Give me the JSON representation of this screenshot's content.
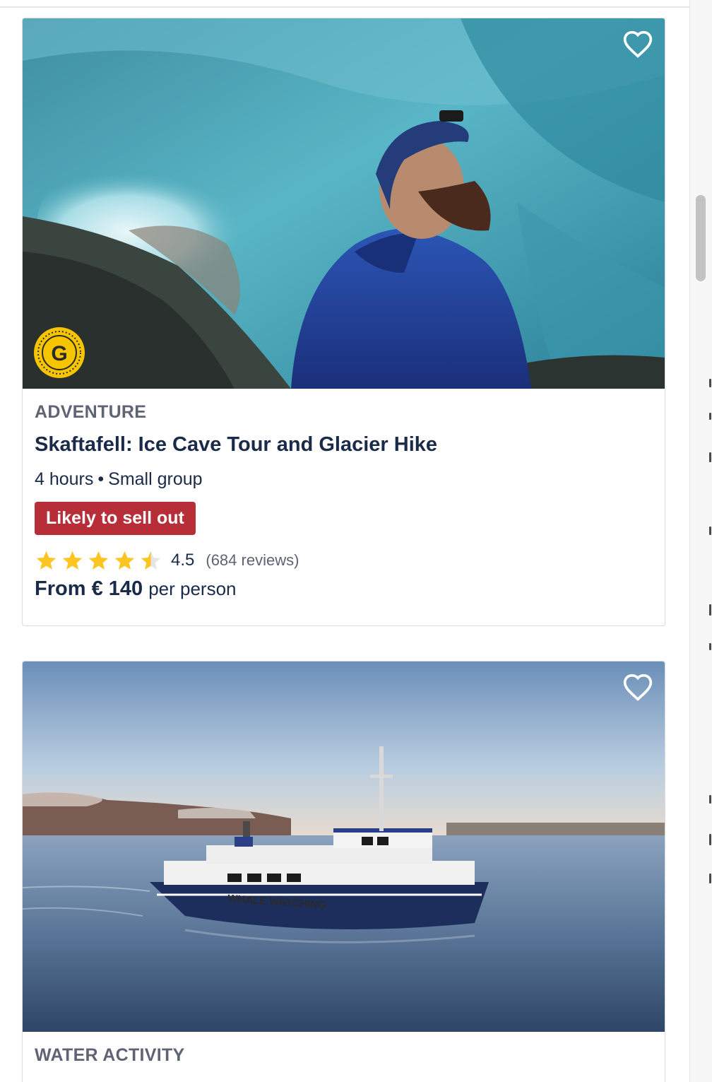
{
  "colors": {
    "title": "#1a2b49",
    "category": "#5f6374",
    "sellout_bg": "#b82e38",
    "star": "#fdc521"
  },
  "cards": [
    {
      "category": "ADVENTURE",
      "title": "Skaftafell: Ice Cave Tour and Glacier Hike",
      "duration": "4 hours",
      "separator": "•",
      "group": "Small group",
      "badge_label": "Likely to sell out",
      "rating_value": "4.5",
      "rating_score": 4.5,
      "reviews": "(684 reviews)",
      "price_prefix": "From",
      "price_amount": "€ 140",
      "price_unit": "per person",
      "wishlist_icon": "heart-outline-icon",
      "image_subject": "ice-cave-hiker",
      "original_badge_letter": "G"
    },
    {
      "category": "WATER ACTIVITY",
      "wishlist_icon": "heart-outline-icon",
      "image_subject": "whale-watching-boat",
      "boat_label": "WHALE WATCHING"
    }
  ]
}
